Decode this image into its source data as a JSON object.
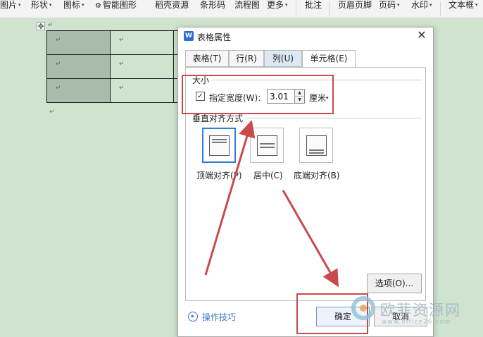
{
  "ribbon": {
    "items": [
      {
        "label": "图片",
        "caret": "▾"
      },
      {
        "label": "形状",
        "caret": "▾"
      },
      {
        "label": "图标",
        "caret": "▾"
      },
      {
        "label": "智能图形",
        "caret": ""
      },
      {
        "label": "稻壳资源",
        "caret": ""
      },
      {
        "label": "条形码",
        "caret": ""
      },
      {
        "label": "流程图",
        "caret": ""
      },
      {
        "label": "更多",
        "caret": "▾"
      },
      {
        "label": "批注",
        "caret": ""
      },
      {
        "label": "页眉页脚",
        "caret": ""
      },
      {
        "label": "页码",
        "caret": "▾"
      },
      {
        "label": "水印",
        "caret": "▾"
      },
      {
        "label": "文本框",
        "caret": "▾"
      }
    ]
  },
  "document": {
    "move_handle": "✥",
    "para_mark": "↵",
    "rows": [
      [
        "↵",
        "↵",
        "↵"
      ],
      [
        "↵",
        "↵",
        "↵"
      ],
      [
        "↵",
        "↵",
        "↵"
      ]
    ]
  },
  "dialog": {
    "app_icon": "W",
    "title": "表格属性",
    "close_symbol": "✕",
    "tabs": [
      {
        "label": "表格(T)"
      },
      {
        "label": "行(R)"
      },
      {
        "label": "列(U)"
      },
      {
        "label": "单元格(E)"
      }
    ],
    "size_group": {
      "title": "大小",
      "checkbox_checked": true,
      "checkbox_mark": "✓",
      "checkbox_label": "指定宽度(W):",
      "width_value": "3.01",
      "spin_up": "▲",
      "spin_down": "▼",
      "unit": "厘米",
      "unit_caret": "▾"
    },
    "valign_group": {
      "title": "垂直对齐方式",
      "options": [
        {
          "label": "顶端对齐(P)",
          "selected": true
        },
        {
          "label": "居中(C)",
          "selected": false
        },
        {
          "label": "底端对齐(B)",
          "selected": false
        }
      ]
    },
    "options_button": "选项(O)...",
    "tips_icon": "▶",
    "tips_link": "操作技巧",
    "ok_button": "确定",
    "cancel_button": "取消"
  },
  "watermark": {
    "text": "欧菲资源网",
    "url": "www.office26.com"
  },
  "colors": {
    "annotation": "#c84a4a",
    "page_background": "#cfe3cf",
    "cell_shade": "#a9bba9",
    "selection": "#2f7fd3",
    "link": "#3a74c9"
  }
}
